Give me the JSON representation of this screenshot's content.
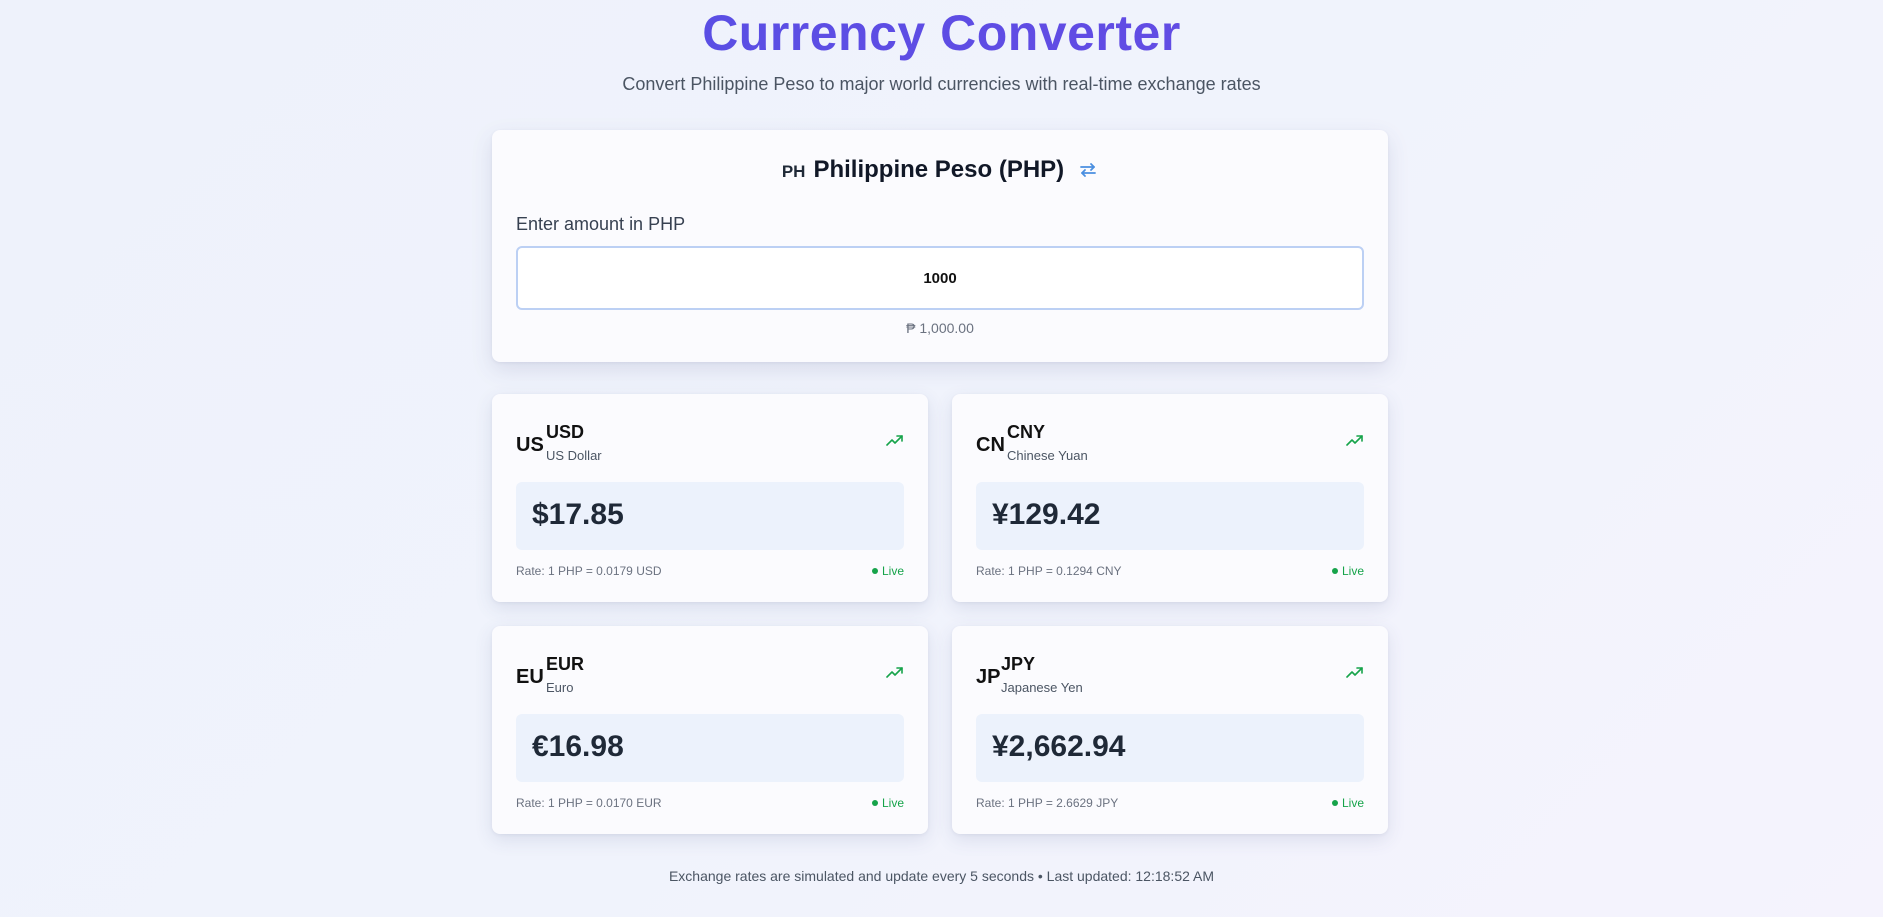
{
  "header": {
    "title": "Currency Converter",
    "subtitle": "Convert Philippine Peso to major world currencies with real-time exchange rates"
  },
  "base": {
    "country_code": "PH",
    "name": "Philippine Peso (PHP)",
    "amount_label": "Enter amount in PHP",
    "amount_value": "1000",
    "formatted_amount": "₱ 1,000.00",
    "swap_icon": "swap-arrows-icon"
  },
  "cards": [
    {
      "country_code": "US",
      "code": "USD",
      "name": "US Dollar",
      "value": "$17.85",
      "rate": "Rate: 1 PHP = 0.0179 USD",
      "status": "Live",
      "trend_icon": "trending-up-icon"
    },
    {
      "country_code": "CN",
      "code": "CNY",
      "name": "Chinese Yuan",
      "value": "¥129.42",
      "rate": "Rate: 1 PHP = 0.1294 CNY",
      "status": "Live",
      "trend_icon": "trending-up-icon"
    },
    {
      "country_code": "EU",
      "code": "EUR",
      "name": "Euro",
      "value": "€16.98",
      "rate": "Rate: 1 PHP = 0.0170 EUR",
      "status": "Live",
      "trend_icon": "trending-up-icon"
    },
    {
      "country_code": "JP",
      "code": "JPY",
      "name": "Japanese Yen",
      "value": "¥2,662.94",
      "rate": "Rate: 1 PHP = 2.6629 JPY",
      "status": "Live",
      "trend_icon": "trending-up-icon"
    }
  ],
  "footer": {
    "text": "Exchange rates are simulated and update every 5 seconds • Last updated: 12:18:52 AM"
  },
  "colors": {
    "title_start": "#4f52e6",
    "title_end": "#6d48e2",
    "live": "#16a34a",
    "swap": "#4a8fe0",
    "value_box": "#ecf2fc"
  }
}
